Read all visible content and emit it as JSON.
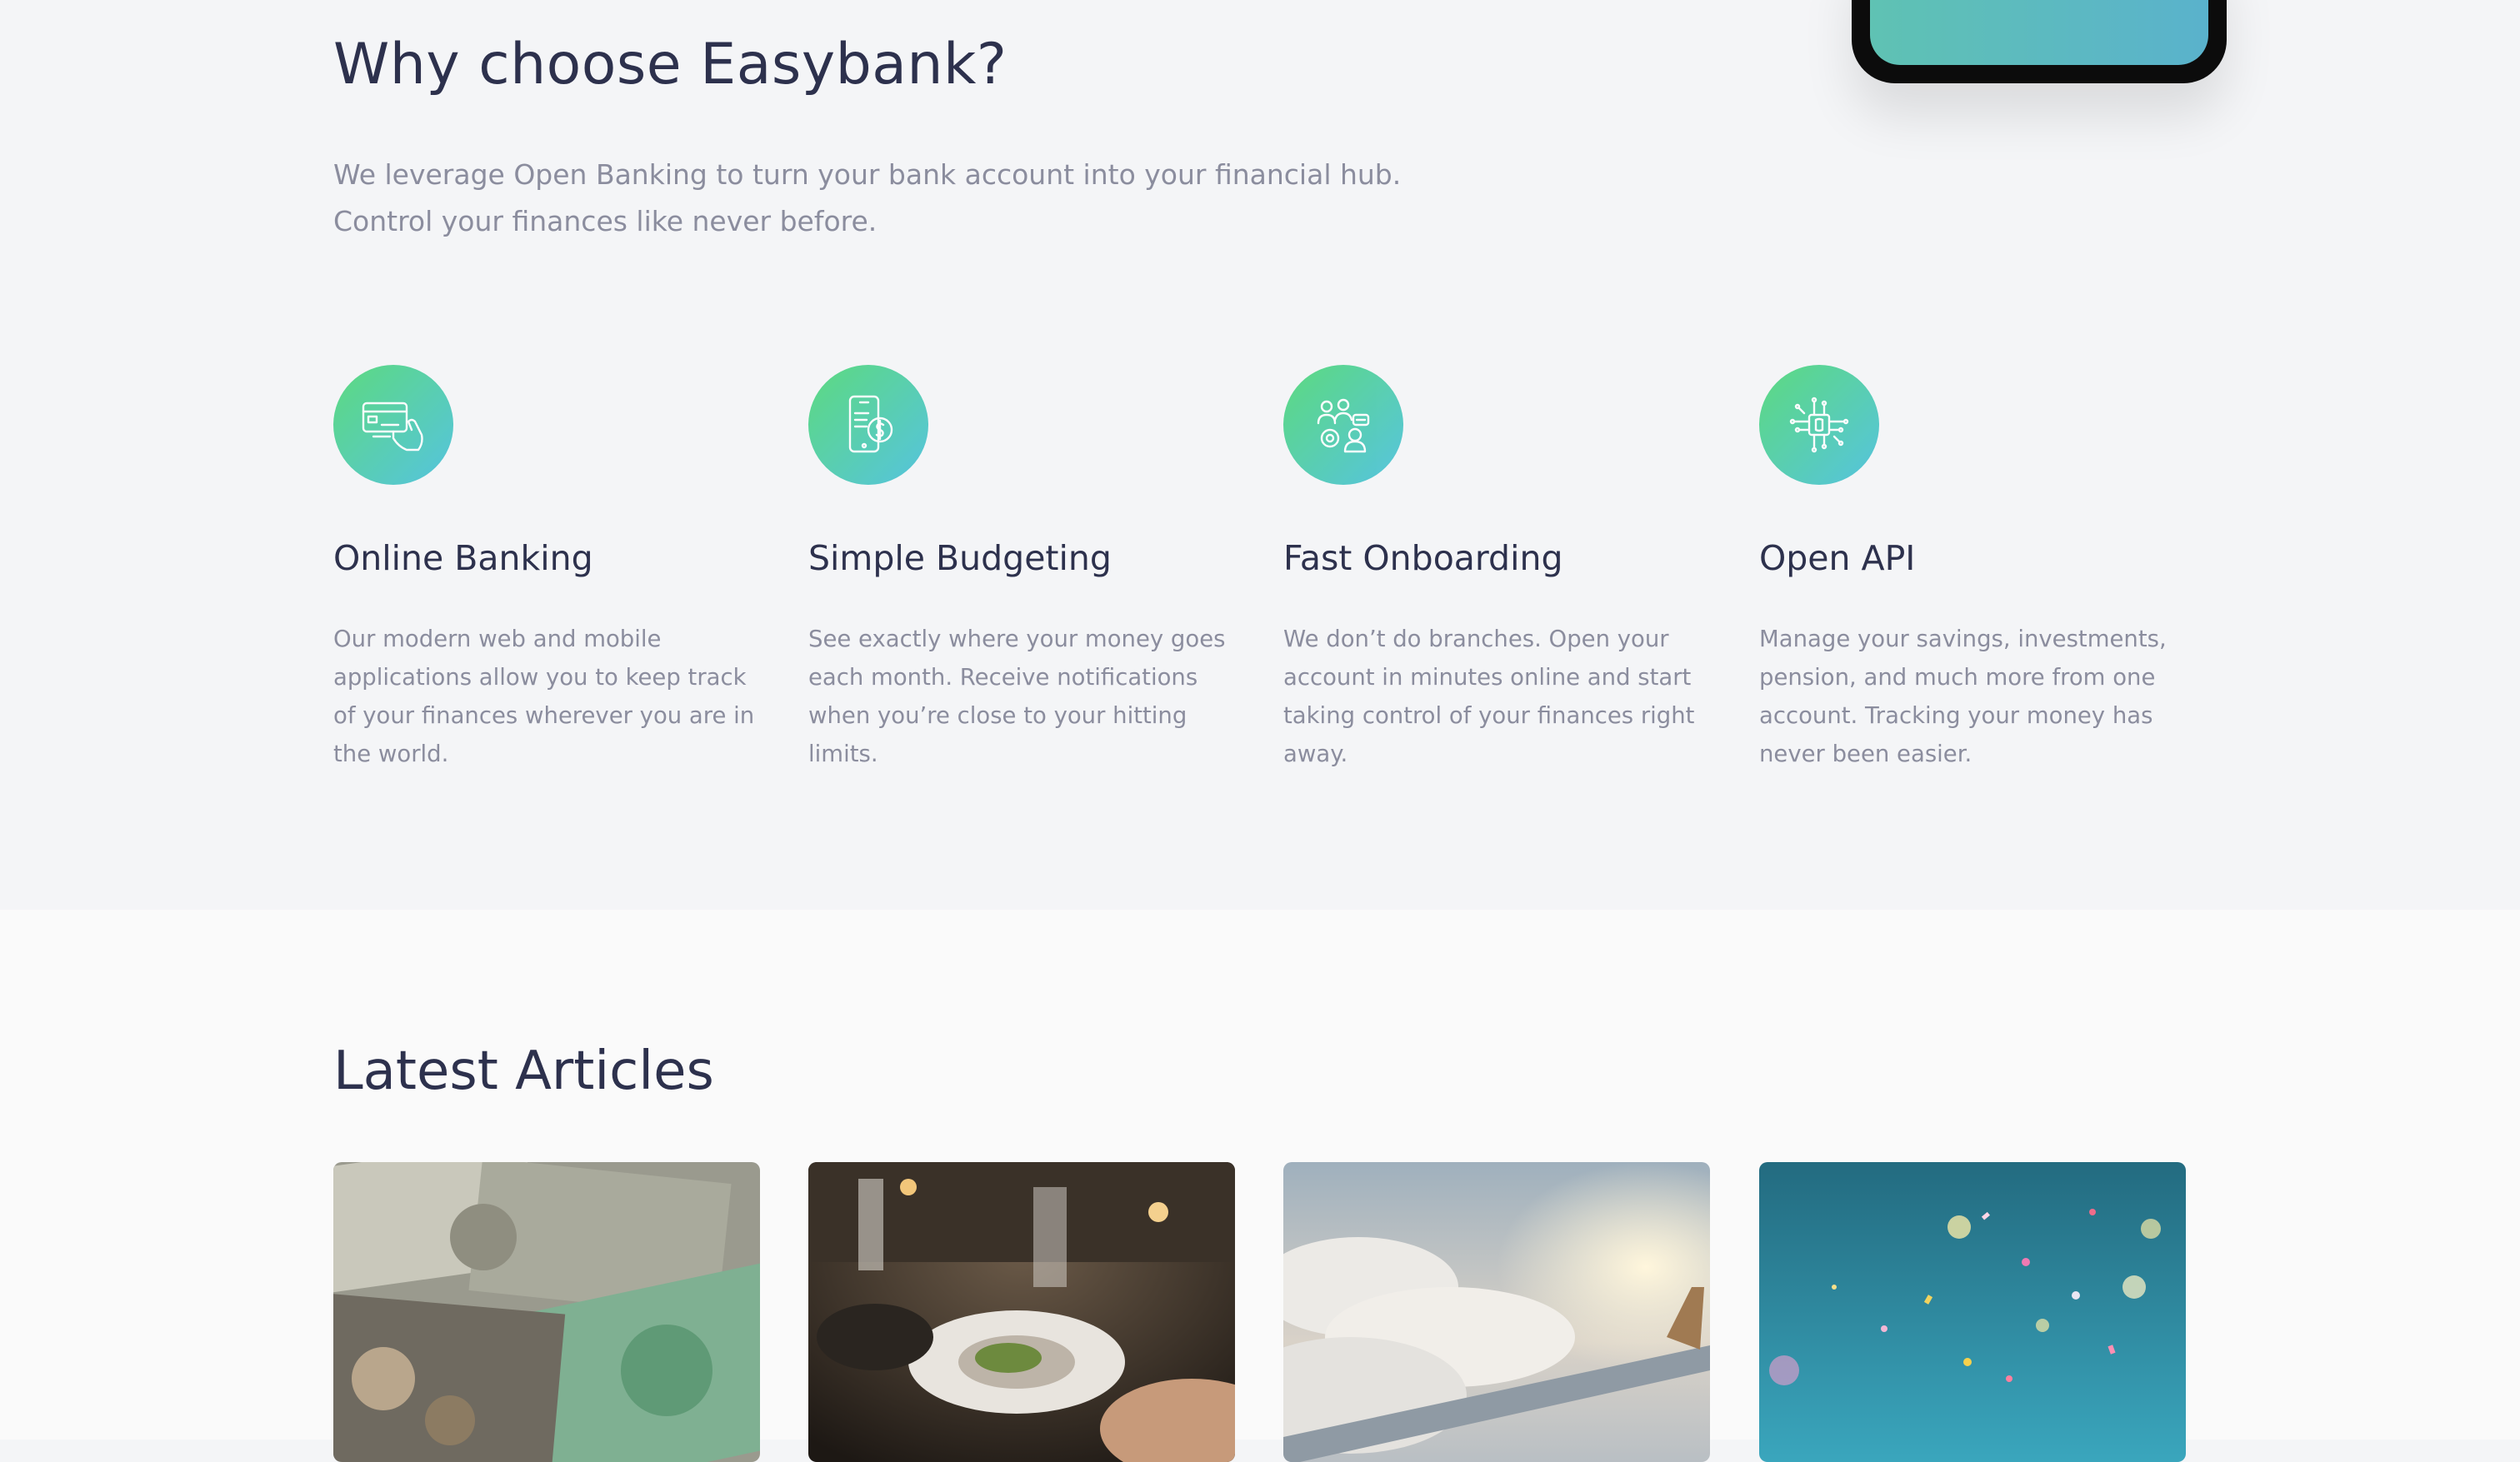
{
  "why": {
    "title": "Why choose Easybank?",
    "subtitle_line1": "We leverage Open Banking to turn your bank account into your financial hub.",
    "subtitle_line2": "Control your finances like never before."
  },
  "features": [
    {
      "icon": "online-banking-icon",
      "title": "Online Banking",
      "description": "Our modern web and mobile applications allow you to keep track of your finances wherever you are in the world."
    },
    {
      "icon": "budgeting-icon",
      "title": "Simple Budgeting",
      "description": "See exactly where your money goes each month. Receive notifications when you’re close to your hitting limits."
    },
    {
      "icon": "onboarding-icon",
      "title": "Fast Onboarding",
      "description": "We don’t do branches. Open your account in minutes online and start taking control of your finances right away."
    },
    {
      "icon": "api-icon",
      "title": "Open API",
      "description": "Manage your savings, investments, pension, and much more from one account. Tracking your money has never been easier."
    }
  ],
  "articles": {
    "title": "Latest Articles",
    "cards": [
      {
        "image": "currency-photo"
      },
      {
        "image": "restaurant-photo"
      },
      {
        "image": "plane-photo"
      },
      {
        "image": "confetti-photo"
      }
    ]
  },
  "colors": {
    "heading": "#2d314d",
    "body_text": "#8b8d9e",
    "gradient_start": "#33d35e",
    "gradient_end": "#2ab6d9",
    "section_bg": "#f4f5f7",
    "articles_bg": "#fafafa"
  }
}
